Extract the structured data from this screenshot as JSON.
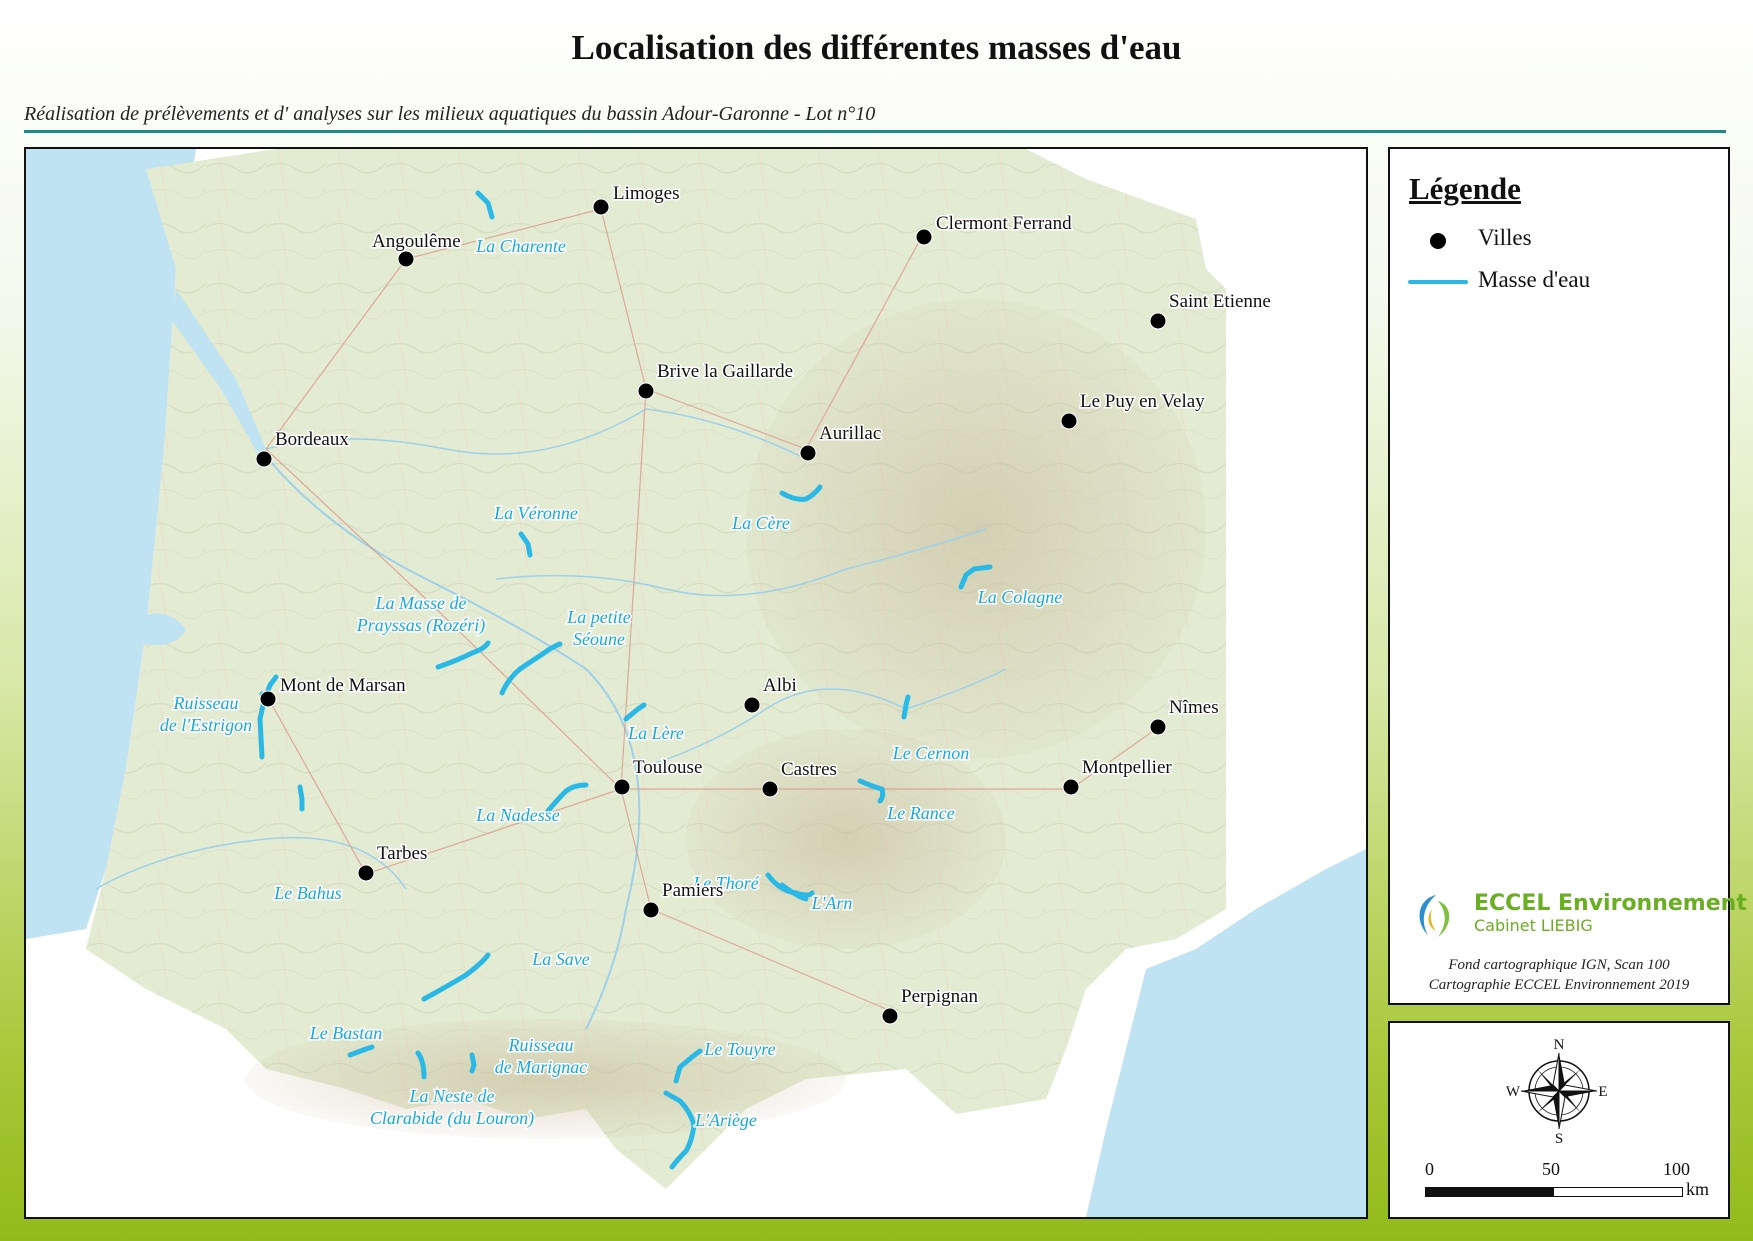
{
  "title": "Localisation des différentes masses d'eau",
  "subtitle": "Réalisation de prélèvements et d' analyses sur les milieux aquatiques du bassin Adour-Garonne - Lot n°10",
  "legend": {
    "title": "Légende",
    "cities_label": "Villes",
    "water_label": "Masse d'eau"
  },
  "logo": {
    "name": "ECCEL Environnement",
    "sub": "Cabinet LIEBIG"
  },
  "credits": {
    "line1": "Fond cartographique IGN, Scan 100",
    "line2": "Cartographie ECCEL Environnement 2019"
  },
  "compass": {
    "n": "N",
    "s": "S",
    "e": "E",
    "w": "W"
  },
  "scale": {
    "labels": [
      "0",
      "50",
      "100"
    ],
    "unit": "km"
  },
  "colors": {
    "water": "#2ab9e6",
    "sea": "#bfe3f2",
    "frame": "#1b8c86"
  },
  "cities": [
    "Limoges",
    "Angoulême",
    "Clermont Ferrand",
    "Saint Etienne",
    "Brive la Gaillarde",
    "Le Puy en Velay",
    "Bordeaux",
    "Aurillac",
    "Mont de Marsan",
    "Albi",
    "Nîmes",
    "Toulouse",
    "Castres",
    "Montpellier",
    "Tarbes",
    "Pamiers",
    "Perpignan"
  ],
  "water_bodies": [
    "La Charente",
    "La Véronne",
    "La Cère",
    "La Colagne",
    "La Masse de\nPrayssas (Rozéri)",
    "La petite\nSéoune",
    "Ruisseau\nde l'Estrigon",
    "La Lère",
    "Le Cernon",
    "La Nadesse",
    "Le Rance",
    "Le Bahus",
    "Le Thoré",
    "L'Arn",
    "La Save",
    "Le Bastan",
    "Ruisseau\nde Marignac",
    "Le Touyre",
    "La Neste de\nClarabide (du Louron)",
    "L'Ariège"
  ]
}
